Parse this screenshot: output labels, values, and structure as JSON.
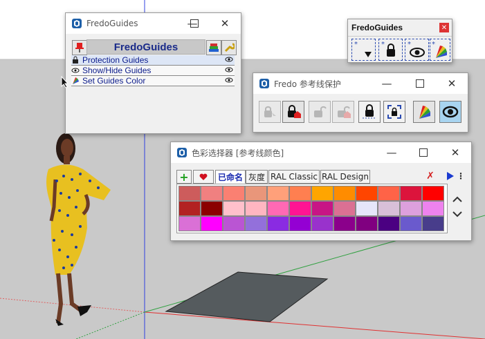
{
  "fredo_main": {
    "title": "FredoGuides",
    "header": "FredoGuides",
    "items": [
      {
        "label": "Protection Guides"
      },
      {
        "label": "Show/Hide Guides"
      },
      {
        "label": "Set Guides Color"
      }
    ]
  },
  "fredo_small": {
    "title": "FredoGuides"
  },
  "fredo_protect": {
    "title": "Fredo  参考线保护"
  },
  "color_picker": {
    "title": "色彩选择器 [参考线颜色]",
    "tabs": [
      "已命名",
      "灰度",
      "RAL Classic",
      "RAL Design"
    ],
    "swatches": [
      [
        "#cd5c5c",
        "#f08080",
        "#fa8072",
        "#e9967a",
        "#ffa07a",
        "#ff7f50",
        "#ffa500",
        "#ff8c00",
        "#ff4500",
        "#ff6347",
        "#dc143c",
        "#ff0000"
      ],
      [
        "#b22222",
        "#8b0000",
        "#ffc0cb",
        "#ffb6c1",
        "#ff69b4",
        "#ff1493",
        "#c71585",
        "#db7093",
        "#e6e6fa",
        "#d8bfd8",
        "#dda0dd",
        "#ee82ee"
      ],
      [
        "#da70d6",
        "#ff00ff",
        "#ba55d3",
        "#9370db",
        "#8a2be2",
        "#9400d3",
        "#9932cc",
        "#8b008b",
        "#800080",
        "#4b0082",
        "#6a5acd",
        "#483d8b"
      ]
    ]
  },
  "colors": {
    "sky": "#ffffff",
    "ground": "#c9c9c9",
    "title_blue": "#1a2b8a",
    "accent_red": "#d42020"
  }
}
